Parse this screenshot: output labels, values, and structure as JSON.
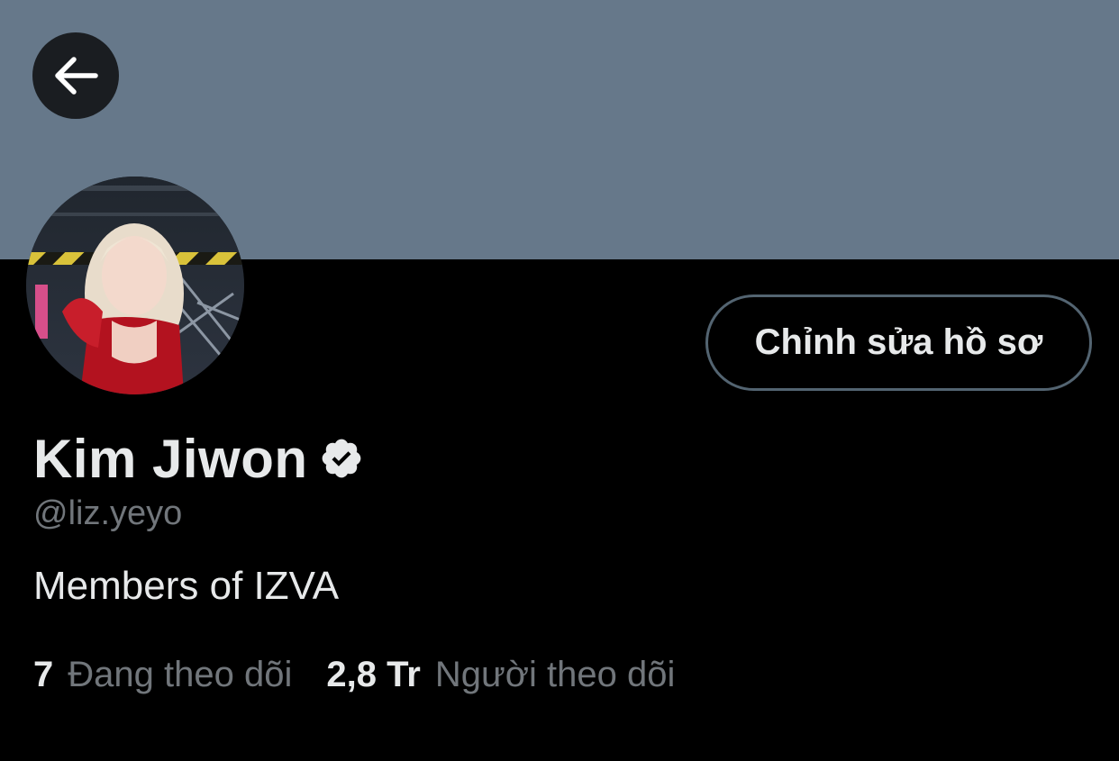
{
  "colors": {
    "banner": "#66788a",
    "background": "#000000",
    "primary_text": "#e7e9ea",
    "secondary_text": "#71767b",
    "button_border": "#536471",
    "back_button_bg": "#1a1d21"
  },
  "header": {
    "back_icon": "arrow-left-icon"
  },
  "profile": {
    "display_name": "Kim Jiwon",
    "verified_icon": "verified-badge-icon",
    "handle": "@liz.yeyo",
    "bio": "Members of IZVA",
    "edit_button_label": "Chỉnh sửa hồ sơ"
  },
  "stats": {
    "following": {
      "value": "7",
      "label": "Đang theo dõi"
    },
    "followers": {
      "value": "2,8 Tr",
      "label": "Người theo dõi"
    }
  }
}
